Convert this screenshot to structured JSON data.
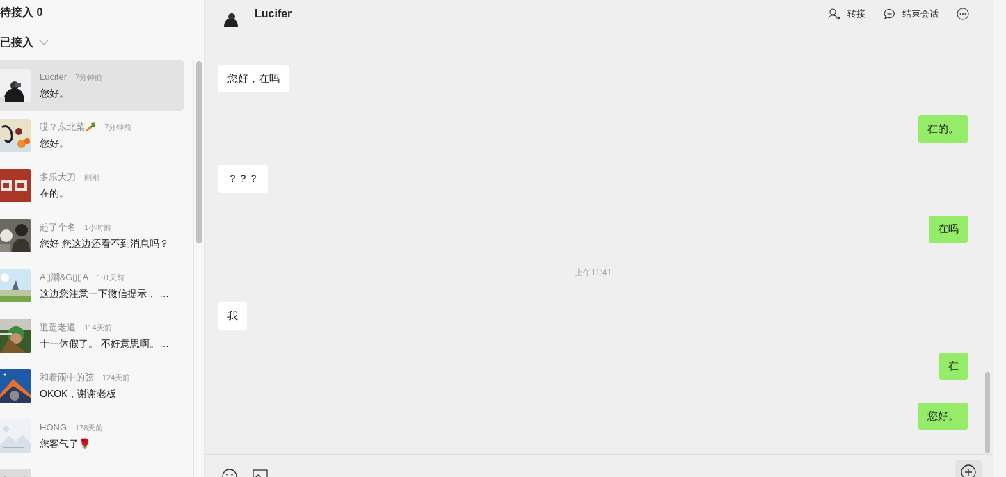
{
  "sidebar": {
    "waiting_title": "待接入 0",
    "accepted_title": "已接入",
    "accepted_expanded": true,
    "conversations": [
      {
        "kind": "contact",
        "name": "Lucifer",
        "time": "7分钟前",
        "preview": "您好。",
        "selected": true
      },
      {
        "kind": "contact",
        "name": "哎？东北菜🥕",
        "time": "7分钟前",
        "preview": "您好。",
        "selected": false
      },
      {
        "kind": "contact",
        "name": "多乐大刀",
        "time": "刚刚",
        "preview": "在的。",
        "selected": false
      },
      {
        "kind": "contact",
        "name": "起了个名",
        "time": "1小时前",
        "preview": "您好 您这边还看不到消息吗？",
        "selected": false
      },
      {
        "kind": "contact",
        "name": "A▯潮&G▯▯A",
        "time": "101天前",
        "preview": "这边您注意一下微信提示， …",
        "selected": false
      },
      {
        "kind": "contact",
        "name": "逍遥老道",
        "time": "114天前",
        "preview": "十一休假了。 不好意思啊。…",
        "selected": false
      },
      {
        "kind": "contact",
        "name": "和着雨中的弦",
        "time": "124天前",
        "preview": "OKOK，谢谢老板",
        "selected": false
      },
      {
        "kind": "contact",
        "name": "HONG",
        "time": "178天前",
        "preview": "您客气了🌹",
        "selected": false
      },
      {
        "kind": "partial"
      }
    ]
  },
  "chat": {
    "contact_name": "Lucifer",
    "actions": [
      {
        "kind": "transfer",
        "label": "转接"
      },
      {
        "kind": "end",
        "label": "结束会话"
      },
      {
        "kind": "more"
      }
    ],
    "messages": [
      {
        "kind": "incoming",
        "text": "您好，在吗"
      },
      {
        "kind": "outgoing",
        "text": "在的。"
      },
      {
        "kind": "incoming",
        "text": "？？？"
      },
      {
        "kind": "outgoing",
        "text": "在吗"
      },
      {
        "kind": "time",
        "text": "上午11:41"
      },
      {
        "kind": "incoming",
        "text": "我"
      },
      {
        "kind": "outgoing",
        "text": "在"
      },
      {
        "kind": "outgoing",
        "text": "您好。"
      }
    ]
  }
}
